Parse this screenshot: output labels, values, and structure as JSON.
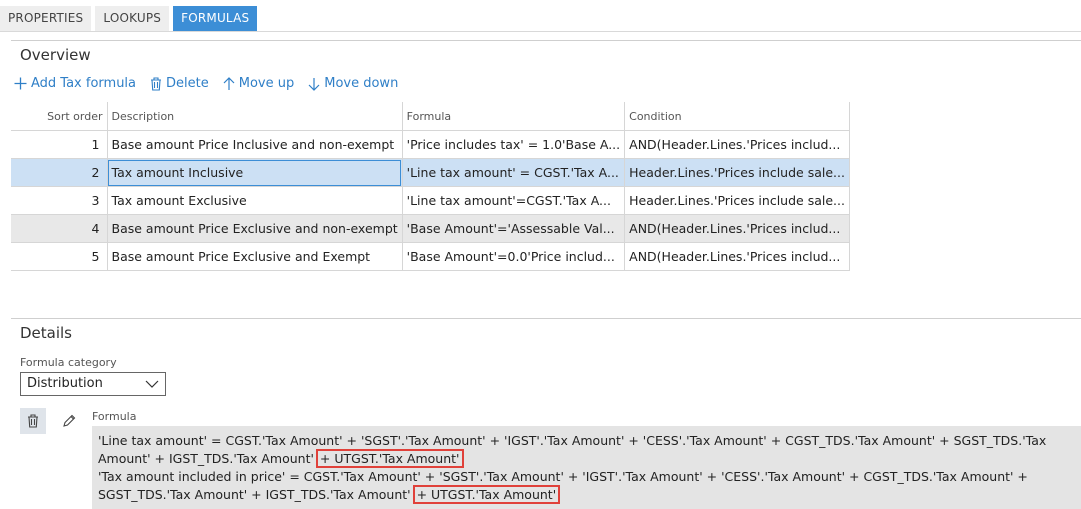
{
  "tabs": [
    {
      "label": "PROPERTIES",
      "active": false
    },
    {
      "label": "LOOKUPS",
      "active": false
    },
    {
      "label": "FORMULAS",
      "active": true
    }
  ],
  "overview": {
    "title": "Overview",
    "toolbar": {
      "add": "Add Tax formula",
      "delete": "Delete",
      "move_up": "Move up",
      "move_down": "Move down"
    },
    "columns": [
      "Sort order",
      "Description",
      "Formula",
      "Condition"
    ],
    "rows": [
      {
        "order": "1",
        "description": "Base amount Price Inclusive and non-exempt",
        "formula": "'Price includes tax' = 1.0'Base A...",
        "condition": "AND(Header.Lines.'Prices includ..."
      },
      {
        "order": "2",
        "description": "Tax amount Inclusive",
        "formula": "'Line tax amount' = CGST.'Tax A...",
        "condition": "Header.Lines.'Prices include sale..."
      },
      {
        "order": "3",
        "description": "Tax amount Exclusive",
        "formula": "'Line tax amount'=CGST.'Tax A...",
        "condition": "Header.Lines.'Prices include sale..."
      },
      {
        "order": "4",
        "description": "Base amount Price Exclusive and non-exempt",
        "formula": "'Base Amount'='Assessable Val...",
        "condition": "AND(Header.Lines.'Prices includ..."
      },
      {
        "order": "5",
        "description": "Base amount Price Exclusive and Exempt",
        "formula": "'Base Amount'=0.0'Price includ...",
        "condition": "AND(Header.Lines.'Prices includ..."
      }
    ],
    "selected_row": 2
  },
  "details": {
    "title": "Details",
    "category_label": "Formula category",
    "category_value": "Distribution",
    "formula_label": "Formula",
    "formula_line1": "'Line tax amount' = CGST.'Tax Amount' + 'SGST'.'Tax Amount' + 'IGST'.'Tax Amount' + 'CESS'.'Tax Amount' + CGST_TDS.'Tax Amount' + SGST_TDS.'Tax Amount' + IGST_TDS.'Tax Amount'",
    "formula_line1_highlight": "+ UTGST.'Tax Amount'",
    "formula_line2": "'Tax amount included in price' = CGST.'Tax Amount' + 'SGST'.'Tax Amount' + 'IGST'.'Tax Amount' + 'CESS'.'Tax Amount' + CGST_TDS.'Tax Amount' + SGST_TDS.'Tax Amount' + IGST_TDS.'Tax Amount'",
    "formula_line2_highlight": "+ UTGST.'Tax Amount'"
  },
  "colors": {
    "accent": "#3c8ed6",
    "highlight": "#e0413a",
    "selected_row": "#cce0f4"
  }
}
